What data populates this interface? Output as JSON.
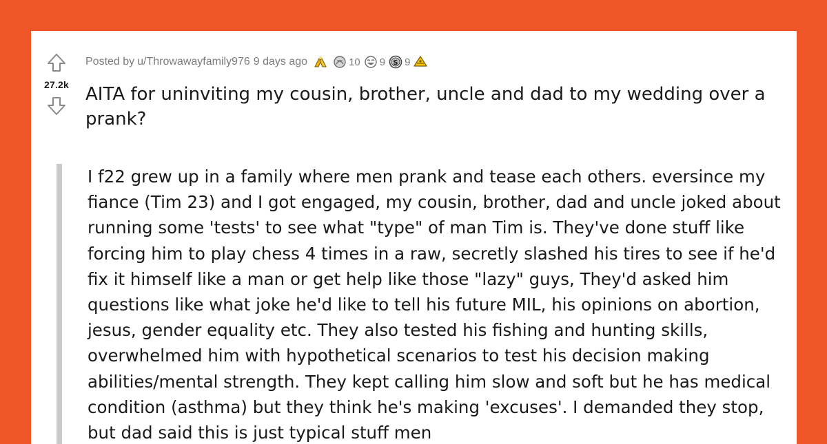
{
  "post": {
    "score": "27.2k",
    "posted_by_prefix": "Posted by",
    "username": "u/Throwawayfamily976",
    "age": "9 days ago",
    "awards": [
      {
        "icon": "hands-award-icon",
        "count": "",
        "color": "#f5b400"
      },
      {
        "icon": "silver-award-icon",
        "count": "10",
        "color": "#8c8c8c"
      },
      {
        "icon": "laughing-award-icon",
        "count": "9",
        "color": "#8c8c8c"
      },
      {
        "icon": "coin-award-icon",
        "count": "9",
        "color": "#555555"
      },
      {
        "icon": "gold-award-icon",
        "count": "",
        "color": "#f5c400"
      }
    ],
    "title": "AITA for uninviting my cousin, brother, uncle and dad to my wedding over a prank?",
    "body": "I f22 grew up in a family where men prank and tease each others. eversince my fiance (Tim 23) and I got engaged, my cousin, brother, dad and uncle joked about running some 'tests' to see what \"type\" of man Tim is. They've done stuff like forcing him to play chess 4 times in a raw, secretly slashed his tires to see if he'd fix it himself like a man or get help like those \"lazy\" guys, They'd asked him questions like what joke he'd like to tell his future MIL, his opinions on abortion, jesus, gender equality etc. They also tested his fishing and hunting skills, overwhelmed him with hypothetical scenarios to test his decision making abilities/mental strength. They kept calling him slow and soft but he has medical condition (asthma) but they think he's making 'excuses'. I demanded they stop, but dad said this is just typical stuff men"
  },
  "colors": {
    "background": "#ee5628",
    "card": "#ffffff",
    "text": "#1a1a1b",
    "meta": "#787c7e",
    "quote_bar": "#c9c9c9"
  }
}
